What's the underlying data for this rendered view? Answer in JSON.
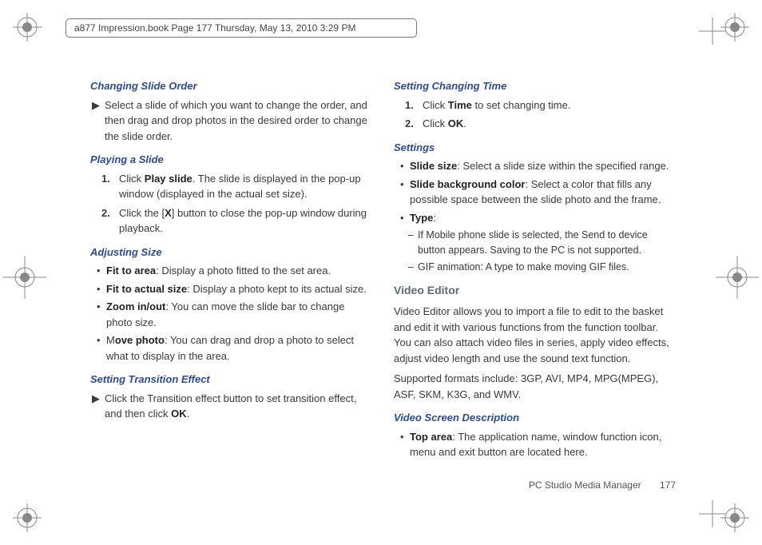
{
  "header": "a877 Impression.book  Page 177  Thursday, May 13, 2010  3:29 PM",
  "left": {
    "h1": "Changing Slide Order",
    "t1": "Select a slide of which you want to change the order, and then drag and drop photos in the desired order to change the slide order.",
    "h2": "Playing a Slide",
    "s2a_pre": "Click ",
    "s2a_bold": "Play slide",
    "s2a_post": ". The slide is displayed in the pop-up window (displayed in the actual set size).",
    "s2b_pre": "Click the [",
    "s2b_bold": "X",
    "s2b_post": "] button to close the pop-up window during playback.",
    "h3": "Adjusting Size",
    "b3a_bold": "Fit to area",
    "b3a_post": ": Display a photo fitted to the set area.",
    "b3b_bold": "Fit to actual size",
    "b3b_post": ": Display a photo kept to its actual size.",
    "b3c_bold": "Zoom in/out",
    "b3c_post": ": You can move the slide bar to change photo size.",
    "b3d_pre": "M",
    "b3d_bold": "ove photo",
    "b3d_post": ": You can drag and drop a photo to select what to display in the area.",
    "h4": "Setting Transition Effect",
    "t4_pre": "Click the Transition effect button to set transition effect, and then click ",
    "t4_bold": "OK",
    "t4_post": "."
  },
  "right": {
    "h1": "Setting Changing Time",
    "s1a_pre": "Click ",
    "s1a_bold": "Time",
    "s1a_post": " to set changing time.",
    "s1b_pre": "Click ",
    "s1b_bold": "OK",
    "s1b_post": ".",
    "h2": "Settings",
    "b2a_bold": "Slide size",
    "b2a_post": ": Select a slide size within the specified range.",
    "b2b_bold": "Slide background color",
    "b2b_post": ": Select a color that fills any possible space between the slide photo and the frame.",
    "b2c_bold": "Type",
    "b2c_post": ":",
    "d2c1": "If Mobile phone slide is selected, the Send to device button appears. Saving to the PC is not supported.",
    "d2c2": "GIF animation: A type to make moving GIF files.",
    "sec3": "Video Editor",
    "p3a": "Video Editor allows you to import a file to edit to the basket and edit it with various functions from the function toolbar. You can also attach video files in series, apply video effects, adjust video length and use the sound text function.",
    "p3b": "Supported formats include: 3GP, AVI, MP4, MPG(MPEG), ASF, SKM, K3G, and WMV.",
    "h4": "Video Screen Description",
    "b4a_bold": "Top area",
    "b4a_post": ": The application name, window function icon, menu and exit button are located here."
  },
  "footer": {
    "label": "PC Studio Media Manager",
    "page": "177"
  },
  "nums": {
    "n1": "1.",
    "n2": "2."
  },
  "marks": {
    "bullet": "•",
    "dash": "–",
    "tri": "▶"
  }
}
